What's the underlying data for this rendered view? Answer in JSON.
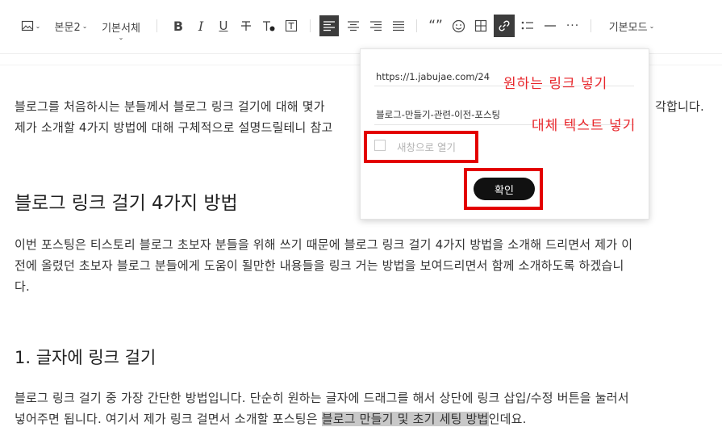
{
  "toolbar": {
    "style_label": "본문2",
    "font_label": "기본서체",
    "mode_label": "기본모드"
  },
  "body": {
    "intro_line1": "블로그를 처음하시는 분들께서 블로그 링크 걸기에 대해 몇가",
    "intro_line1_tail": "각합니다.",
    "intro_line2": "제가 소개할 4가지 방법에 대해 구체적으로 설명드릴테니 참고",
    "heading1": "블로그 링크 걸기 4가지 방법",
    "para2_line1": "이번 포스팅은 티스토리 블로그 초보자 분들을 위해 쓰기 때문에 블로그 링크 걸기 4가지 방법을 소개해 드리면서 제가 이",
    "para2_line2": "전에 올렸던 초보자 블로그 분들에게 도움이 될만한 내용들을 링크 거는 방법을 보여드리면서 함께 소개하도록 하겠습니",
    "para2_line3": "다.",
    "heading2": "1. 글자에 링크 걸기",
    "para3_line1": "블로그 링크 걸기 중 가장 간단한 방법입니다. 단순히 원하는 글자에 드래그를 해서 상단에 링크 삽입/수정 버튼을 눌러서",
    "para3_line2_pre": "넣어주면 됩니다. 여기서 제가 링크 걸면서 소개할 포스팅은 ",
    "para3_line2_hl": "블로그 만들기 및 초기 세팅 방법",
    "para3_line2_post": "인데요."
  },
  "link_popup": {
    "url_value": "https://1.jabujae.com/24",
    "text_value": "블로그-만들기-관련-이전-포스팅",
    "new_window_label": "새창으로 열기",
    "confirm_label": "확인"
  },
  "annotations": {
    "url_note": "원하는 링크 넣기",
    "text_note": "대체 텍스트 넣기"
  },
  "colors": {
    "annotation_red": "#e8262b",
    "active_blue": "#3c3c3c",
    "button_black": "#111111"
  }
}
